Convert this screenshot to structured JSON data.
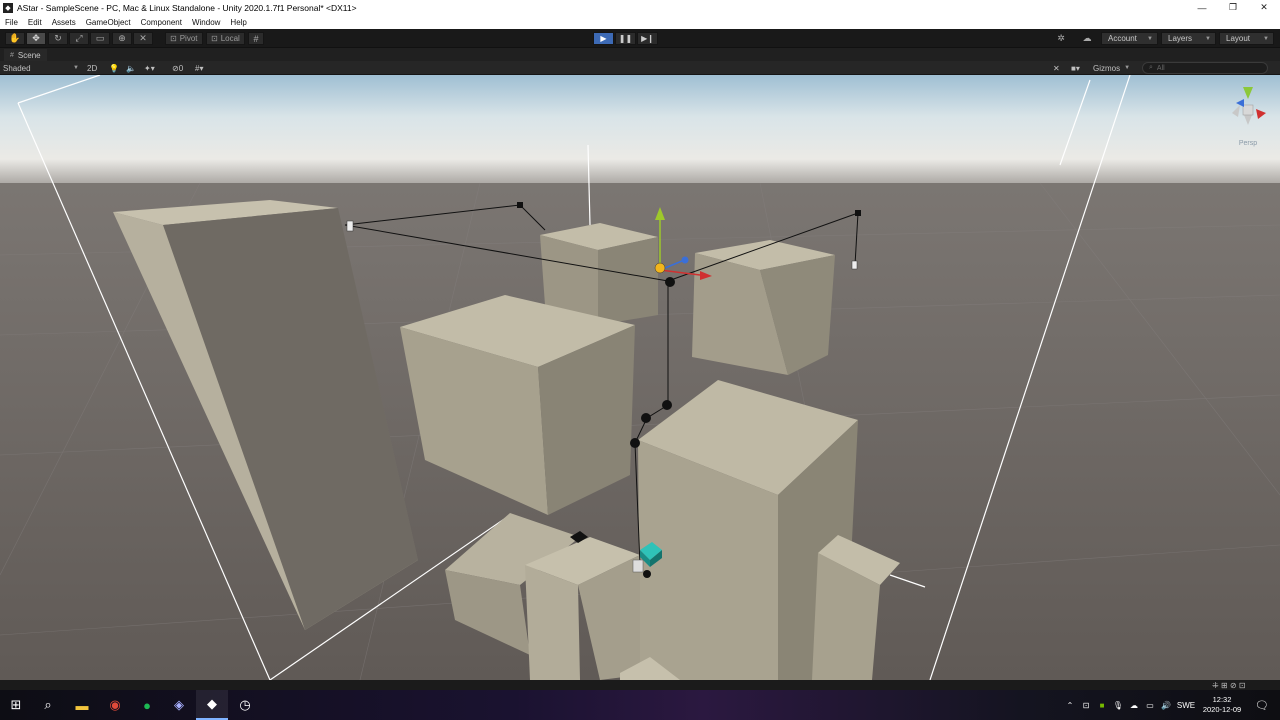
{
  "window": {
    "title": "AStar - SampleScene - PC, Mac & Linux Standalone - Unity 2020.1.7f1 Personal* <DX11>",
    "minimize": "—",
    "maximize": "❐",
    "close": "✕"
  },
  "menu": [
    "File",
    "Edit",
    "Assets",
    "GameObject",
    "Component",
    "Window",
    "Help"
  ],
  "toolbar": {
    "pivot_label": "Pivot",
    "local_label": "Local",
    "account_label": "Account",
    "layers_label": "Layers",
    "layout_label": "Layout"
  },
  "scene": {
    "tab_label": "Scene",
    "shading_mode": "Shaded",
    "mode_2d": "2D",
    "effects_count": "0",
    "gizmos_label": "Gizmos",
    "search_placeholder": "All",
    "persp_label": "Persp"
  },
  "taskbar": {
    "apps": [
      "start-icon",
      "search-icon",
      "file-explorer-icon",
      "chrome-icon",
      "spotify-icon",
      "discord-icon",
      "unity-icon",
      "clock-app-icon"
    ],
    "lang": "SWE",
    "time": "12:32",
    "date": "2020-12-09"
  },
  "colors": {
    "sky_top": "#a9c4d6",
    "ground": "#6b6560",
    "building_top": "#bcb6a2",
    "building_side": "#8f8a7a",
    "play_active": "#3d6ab5",
    "teal_agent": "#1fa8a0"
  }
}
